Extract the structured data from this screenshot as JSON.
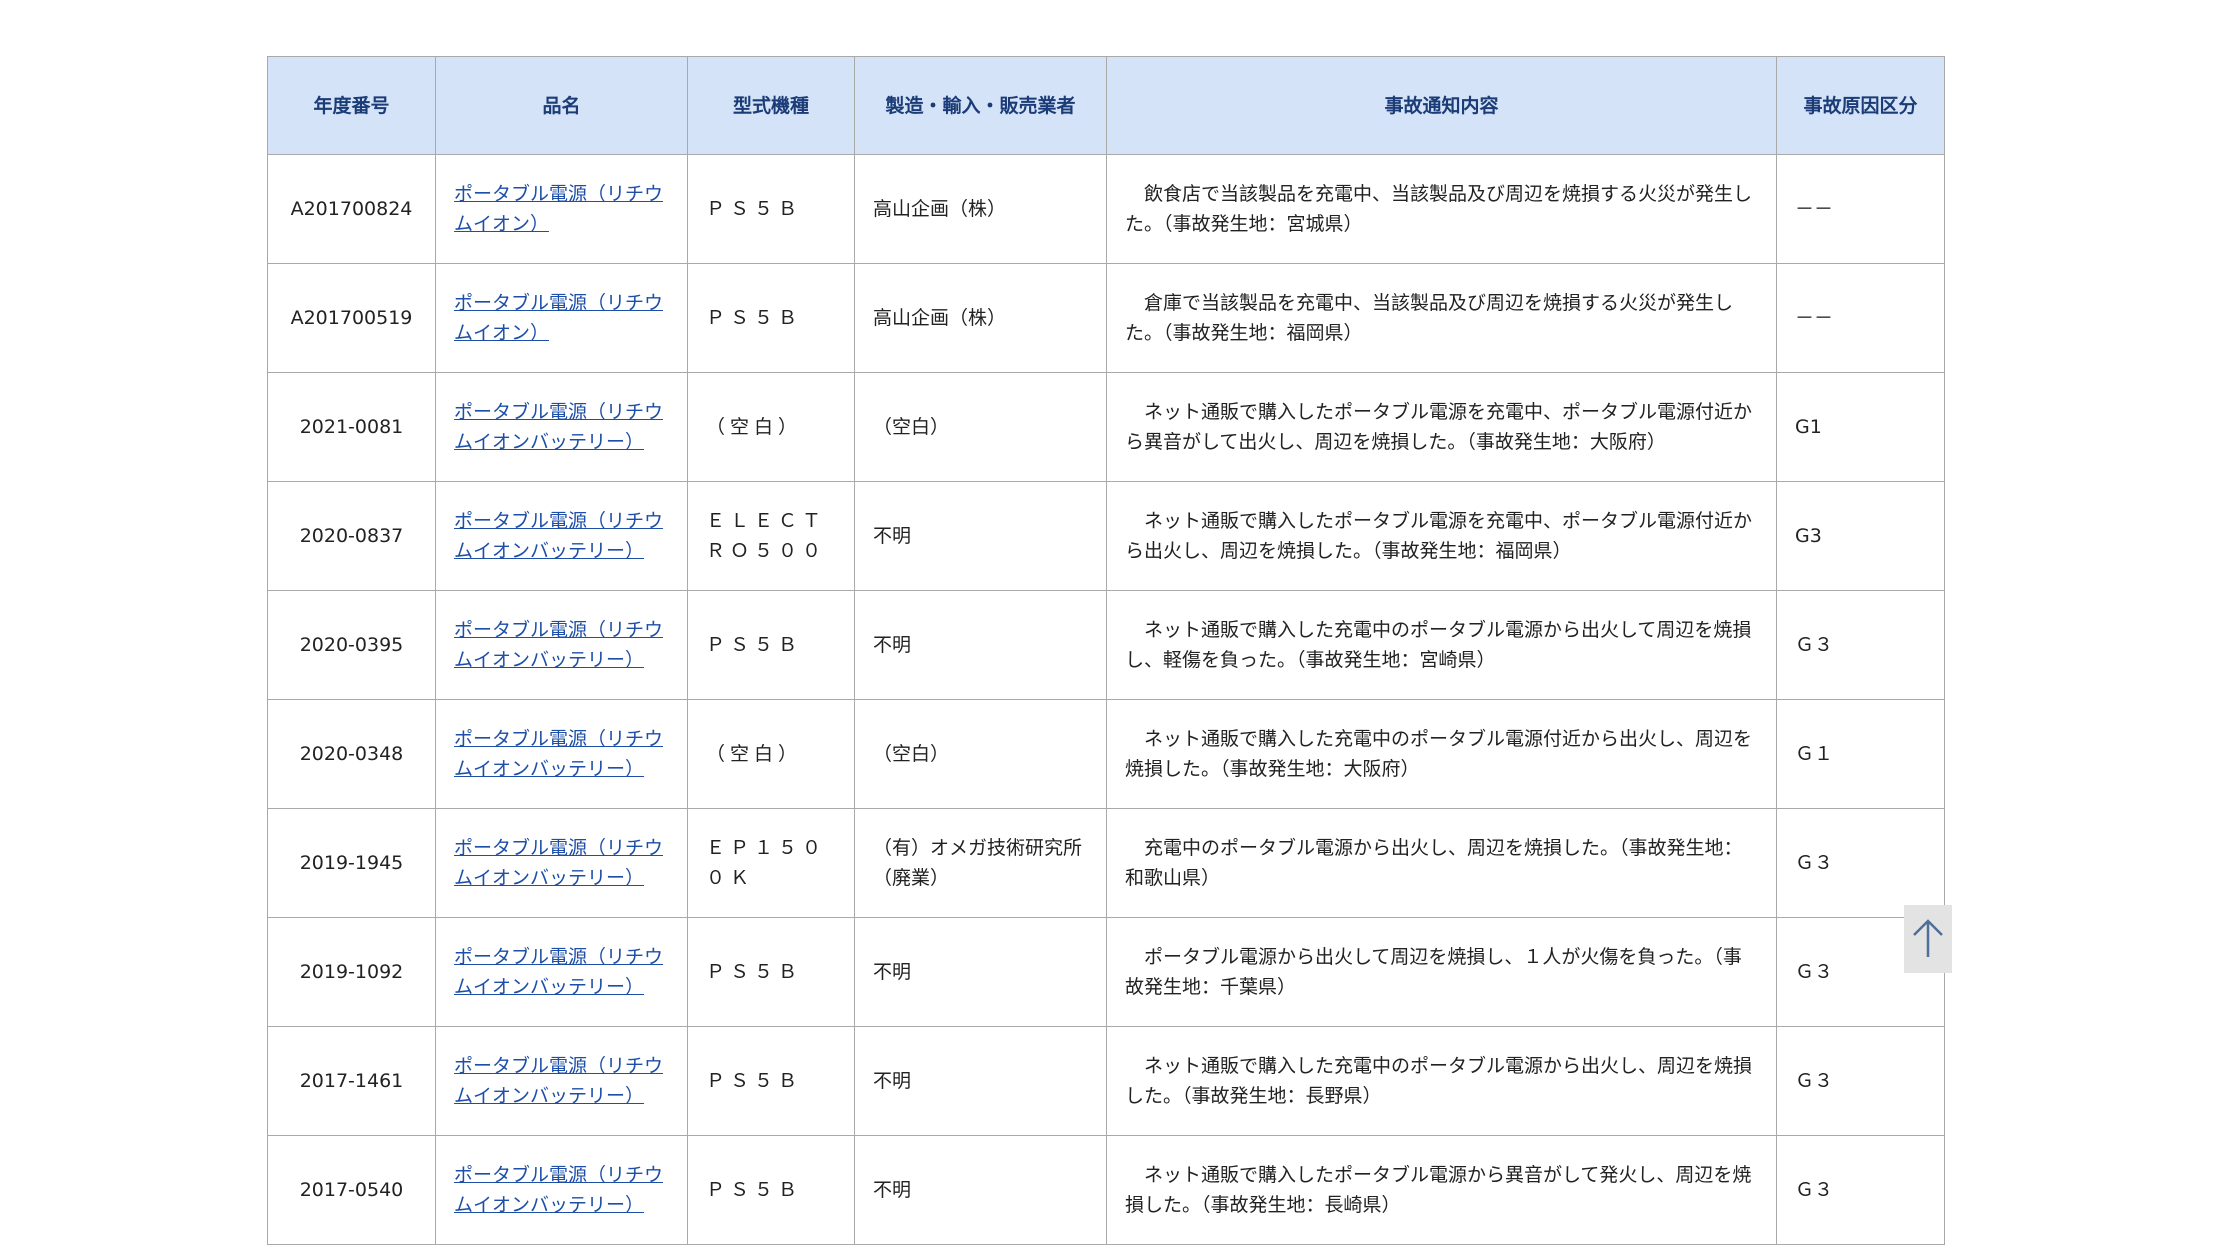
{
  "table": {
    "headers": {
      "id": "年度番号",
      "name": "品名",
      "model": "型式機種",
      "maker": "製造・輸入・販売業者",
      "content": "事故通知内容",
      "cause": "事故原因区分"
    },
    "rows": [
      {
        "id": "A201700824",
        "name": "ポータブル電源（リチウムイオン）",
        "model": "ＰＳ５Ｂ",
        "maker": "高山企画（株）",
        "content": "　飲食店で当該製品を充電中、当該製品及び周辺を焼損する火災が発生した。（事故発生地：宮城県）",
        "cause": "－－"
      },
      {
        "id": "A201700519",
        "name": "ポータブル電源（リチウムイオン）",
        "model": "ＰＳ５Ｂ",
        "maker": "高山企画（株）",
        "content": "　倉庫で当該製品を充電中、当該製品及び周辺を焼損する火災が発生した。（事故発生地：福岡県）",
        "cause": "－－"
      },
      {
        "id": "2021-0081",
        "name": "ポータブル電源（リチウムイオンバッテリー）",
        "model": "（空白）",
        "maker": "（空白）",
        "content": "　ネット通販で購入したポータブル電源を充電中、ポータブル電源付近から異音がして出火し、周辺を焼損した。（事故発生地：大阪府）",
        "cause": "G1"
      },
      {
        "id": "2020-0837",
        "name": "ポータブル電源（リチウムイオンバッテリー）",
        "model": "ＥＬＥＣＴＲＯ５００",
        "maker": "不明",
        "content": "　ネット通販で購入したポータブル電源を充電中、ポータブル電源付近から出火し、周辺を焼損した。（事故発生地：福岡県）",
        "cause": "G3"
      },
      {
        "id": "2020-0395",
        "name": "ポータブル電源（リチウムイオンバッテリー）",
        "model": "ＰＳ５Ｂ",
        "maker": "不明",
        "content": "　ネット通販で購入した充電中のポータブル電源から出火して周辺を焼損し、軽傷を負った。（事故発生地：宮崎県）",
        "cause": "Ｇ３"
      },
      {
        "id": "2020-0348",
        "name": "ポータブル電源（リチウムイオンバッテリー）",
        "model": "（空白）",
        "maker": "（空白）",
        "content": "　ネット通販で購入した充電中のポータブル電源付近から出火し、周辺を焼損した。（事故発生地：大阪府）",
        "cause": "Ｇ１"
      },
      {
        "id": "2019-1945",
        "name": "ポータブル電源（リチウムイオンバッテリー）",
        "model": "ＥＰ１５００Ｋ",
        "maker": "（有）オメガ技術研究所（廃業）",
        "content": "　充電中のポータブル電源から出火し、周辺を焼損した。（事故発生地：和歌山県）",
        "cause": "Ｇ３"
      },
      {
        "id": "2019-1092",
        "name": "ポータブル電源（リチウムイオンバッテリー）",
        "model": "ＰＳ５Ｂ",
        "maker": "不明",
        "content": "　ポータブル電源から出火して周辺を焼損し、１人が火傷を負った。（事故発生地：千葉県）",
        "cause": "Ｇ３"
      },
      {
        "id": "2017-1461",
        "name": "ポータブル電源（リチウムイオンバッテリー）",
        "model": "ＰＳ５Ｂ",
        "maker": "不明",
        "content": "　ネット通販で購入した充電中のポータブル電源から出火し、周辺を焼損した。（事故発生地：長野県）",
        "cause": "Ｇ３"
      },
      {
        "id": "2017-0540",
        "name": "ポータブル電源（リチウムイオンバッテリー）",
        "model": "ＰＳ５Ｂ",
        "maker": "不明",
        "content": "　ネット通販で購入したポータブル電源から異音がして発火し、周辺を焼損した。（事故発生地：長崎県）",
        "cause": "Ｇ３"
      }
    ]
  },
  "scroll_top": {
    "icon": "arrow-up-icon"
  },
  "colors": {
    "header_bg": "#d5e3f8",
    "header_text": "#1b3c77",
    "link": "#1d4ea8",
    "border": "#a9a9a9"
  }
}
